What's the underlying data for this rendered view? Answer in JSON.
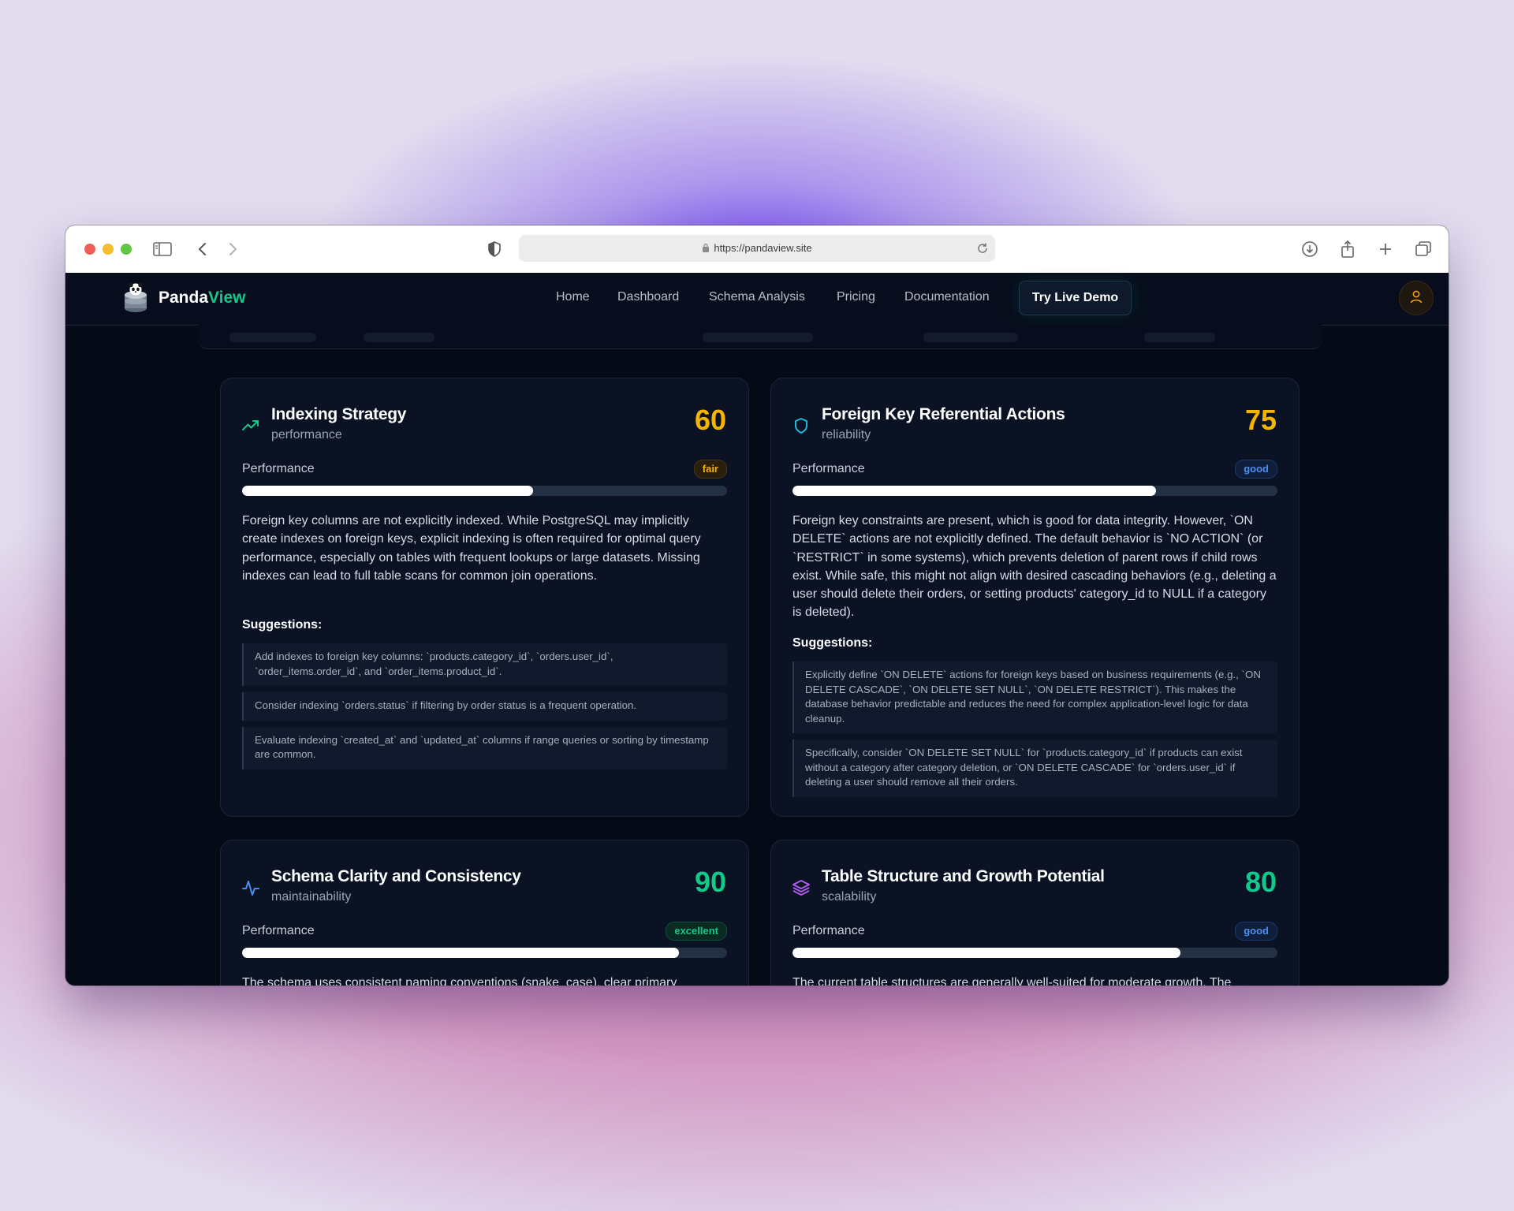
{
  "browser": {
    "url": "https://pandaview.site"
  },
  "nav": {
    "brand_main": "Panda",
    "brand_accent": "View",
    "links": [
      "Home",
      "Dashboard",
      "Schema Analysis",
      "Pricing",
      "Documentation"
    ],
    "cta": "Try Live Demo"
  },
  "colors": {
    "accent": "#10c98a",
    "fair": "#f5b400",
    "good": "#3b82f6",
    "excellent": "#10c98a"
  },
  "cards": [
    {
      "icon": "trending-up-icon",
      "title": "Indexing Strategy",
      "category": "performance",
      "score": "60",
      "performance_label": "Performance",
      "rating": "fair",
      "progress": 0.6,
      "description": "Foreign key columns are not explicitly indexed. While PostgreSQL may implicitly create indexes on foreign keys, explicit indexing is often required for optimal query performance, especially on tables with frequent lookups or large datasets. Missing indexes can lead to full table scans for common join operations.",
      "suggestions_label": "Suggestions:",
      "suggestions": [
        "Add indexes to foreign key columns: `products.category_id`, `orders.user_id`, `order_items.order_id`, and `order_items.product_id`.",
        "Consider indexing `orders.status` if filtering by order status is a frequent operation.",
        "Evaluate indexing `created_at` and `updated_at` columns if range queries or sorting by timestamp are common."
      ]
    },
    {
      "icon": "shield-icon",
      "title": "Foreign Key Referential Actions",
      "category": "reliability",
      "score": "75",
      "performance_label": "Performance",
      "rating": "good",
      "progress": 0.75,
      "description": "Foreign key constraints are present, which is good for data integrity. However, `ON DELETE` actions are not explicitly defined. The default behavior is `NO ACTION` (or `RESTRICT` in some systems), which prevents deletion of parent rows if child rows exist. While safe, this might not align with desired cascading behaviors (e.g., deleting a user should delete their orders, or setting products' category_id to NULL if a category is deleted).",
      "suggestions_label": "Suggestions:",
      "suggestions": [
        "Explicitly define `ON DELETE` actions for foreign keys based on business requirements (e.g., `ON DELETE CASCADE`, `ON DELETE SET NULL`, `ON DELETE RESTRICT`). This makes the database behavior predictable and reduces the need for complex application-level logic for data cleanup.",
        "Specifically, consider `ON DELETE SET NULL` for `products.category_id` if products can exist without a category after category deletion, or `ON DELETE CASCADE` for `orders.user_id` if deleting a user should remove all their orders."
      ]
    },
    {
      "icon": "activity-icon",
      "title": "Schema Clarity and Consistency",
      "category": "maintainability",
      "score": "90",
      "performance_label": "Performance",
      "rating": "excellent",
      "progress": 0.9,
      "description": "The schema uses consistent naming conventions (snake_case), clear primary"
    },
    {
      "icon": "layers-icon",
      "title": "Table Structure and Growth Potential",
      "category": "scalability",
      "score": "80",
      "performance_label": "Performance",
      "rating": "good",
      "progress": 0.8,
      "description": "The current table structures are generally well-suited for moderate growth. The"
    }
  ]
}
